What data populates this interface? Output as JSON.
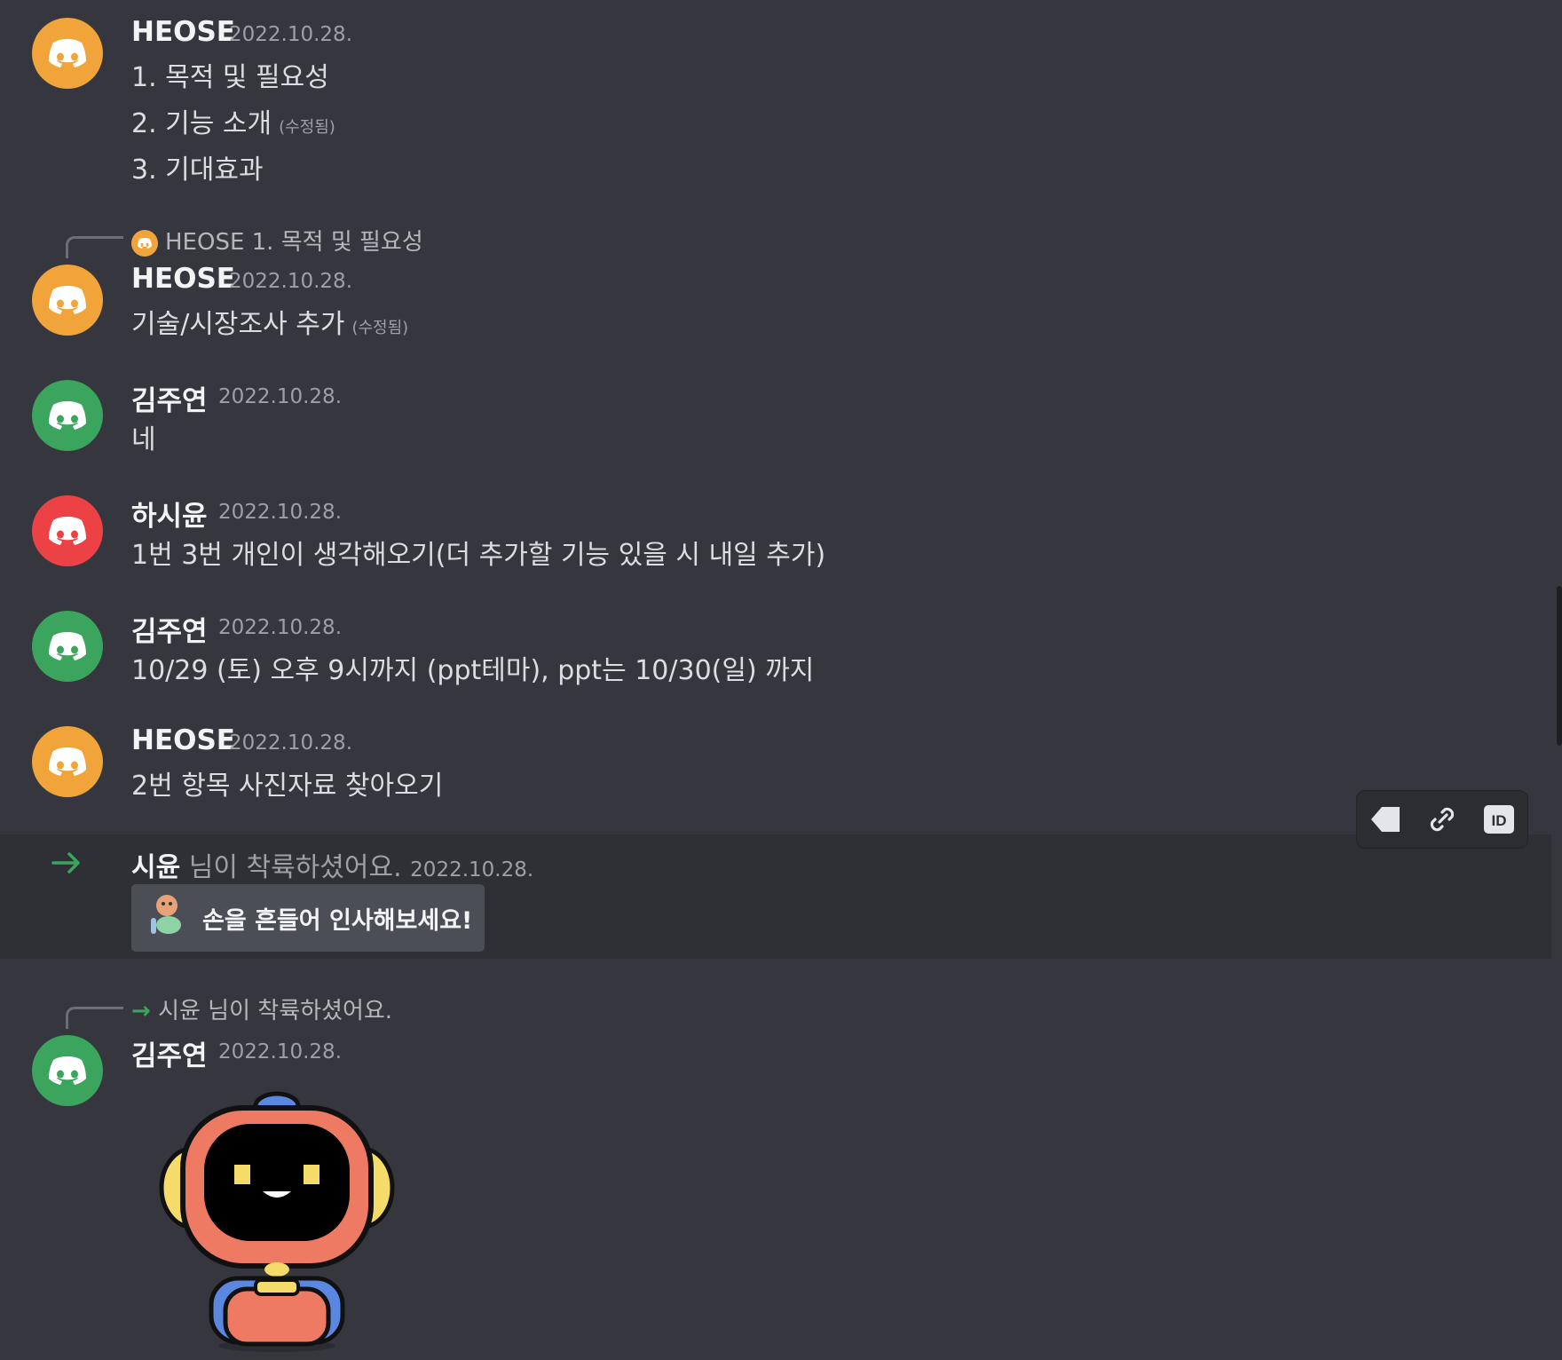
{
  "colors": {
    "background": "#36373e",
    "avatar_orange": "#f0a43a",
    "avatar_green": "#3ba55d",
    "avatar_red": "#ed4245",
    "join_arrow": "#3ba55d"
  },
  "messages": [
    {
      "username": "HEOSE",
      "timestamp": "2022.10.28.",
      "avatar_icon": "discord-logo-icon",
      "lines": [
        "1. 목적 및 필요성",
        "2. 기능 소개",
        "3. 기대효과"
      ],
      "edited_label": "(수정됨)"
    },
    {
      "reply_to": {
        "username": "HEOSE",
        "text": "1. 목적 및 필요성"
      },
      "username": "HEOSE",
      "timestamp": "2022.10.28.",
      "text": "기술/시장조사 추가",
      "edited_label": "(수정됨)"
    },
    {
      "username": "김주연",
      "timestamp": "2022.10.28.",
      "text": "네"
    },
    {
      "username": "하시윤",
      "timestamp": "2022.10.28.",
      "text": "1번 3번 개인이 생각해오기(더 추가할 기능 있을 시 내일 추가)"
    },
    {
      "username": "김주연",
      "timestamp": "2022.10.28.",
      "text": "10/29 (토) 오후 9시까지 (ppt테마), ppt는 10/30(일) 까지"
    },
    {
      "username": "HEOSE",
      "timestamp": "2022.10.28.",
      "text": "2번 항목 사진자료 찾아오기"
    }
  ],
  "join": {
    "username": "시윤",
    "text": "님이 착륙하셨어요.",
    "timestamp": "2022.10.28.",
    "wave_button_label": "손을 흔들어 인사해보세요!"
  },
  "sticker_message": {
    "reply_text": "시윤 님이 착륙하셨어요.",
    "username": "김주연",
    "timestamp": "2022.10.28.",
    "sticker": "wumpus-robot-sticker"
  },
  "hover_toolbar": {
    "icons": [
      "tag-icon",
      "link-icon",
      "id-icon"
    ]
  }
}
